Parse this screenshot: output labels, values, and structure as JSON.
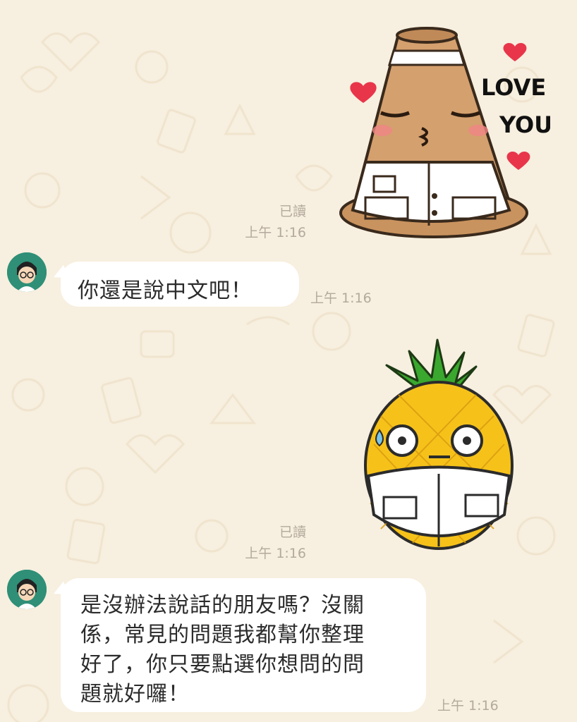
{
  "messages": [
    {
      "type": "sticker",
      "side": "out",
      "sticker_name": "traffic-cone-kiss-sticker",
      "sticker_text_1": "LOVE",
      "sticker_text_2": "YOU",
      "read_label": "已讀",
      "time": "上午 1:16"
    },
    {
      "type": "text",
      "side": "in",
      "text": "你還是說中文吧！",
      "time": "上午 1:16"
    },
    {
      "type": "sticker",
      "side": "out",
      "sticker_name": "pineapple-sweat-sticker",
      "read_label": "已讀",
      "time": "上午 1:16"
    },
    {
      "type": "text",
      "side": "in",
      "lines": [
        "是沒辦法說話的朋友嗎？沒關",
        "係，常見的問題我都幫你整理",
        "好了，你只要點選你想問的問",
        "題就好囉！"
      ],
      "time": "上午 1:16"
    }
  ],
  "colors": {
    "wallpaper": "#f7efdf",
    "bubble": "#ffffff",
    "meta_text": "#b3aa9d",
    "cone": "#d4a06e",
    "heart": "#e8354a",
    "pineapple": "#f6c21a",
    "leaves": "#3aa82e"
  }
}
